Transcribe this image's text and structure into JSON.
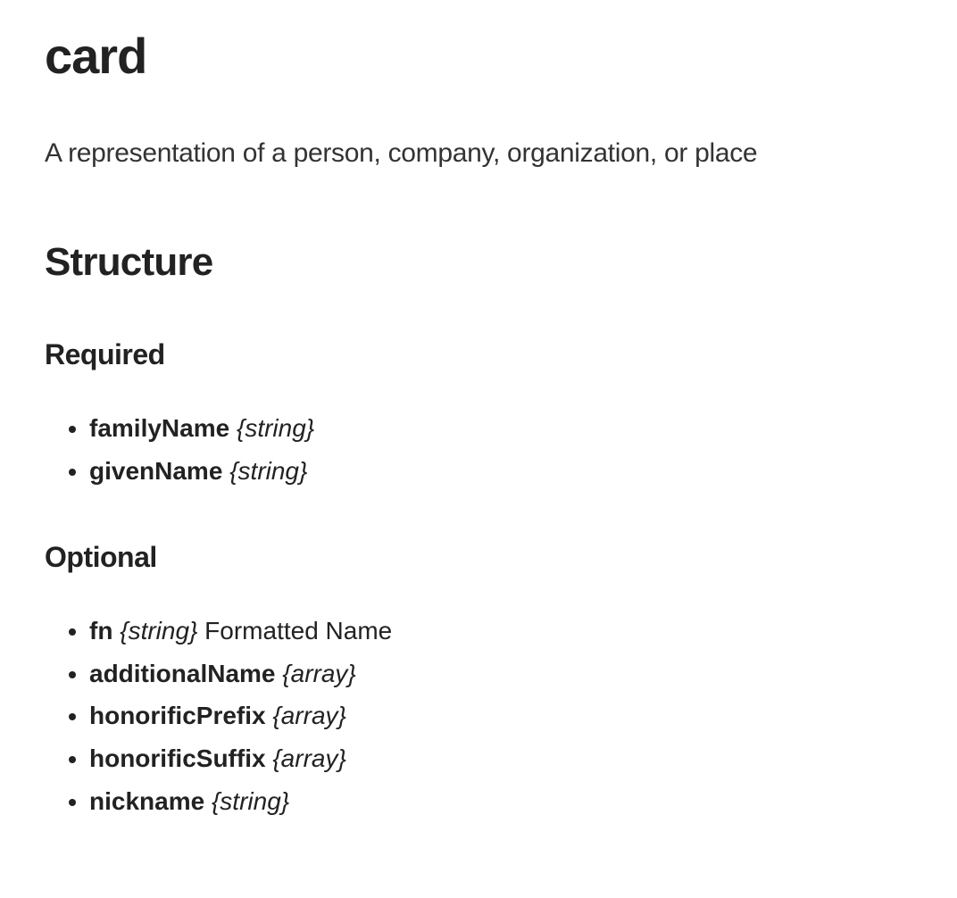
{
  "title": "card",
  "description": "A representation of a person, company, organization, or place",
  "structure": {
    "heading": "Structure",
    "sections": [
      {
        "heading": "Required",
        "props": [
          {
            "name": "familyName",
            "type": "{string}",
            "desc": ""
          },
          {
            "name": "givenName",
            "type": "{string}",
            "desc": ""
          }
        ]
      },
      {
        "heading": "Optional",
        "props": [
          {
            "name": "fn",
            "type": "{string}",
            "desc": "Formatted Name"
          },
          {
            "name": "additionalName",
            "type": "{array}",
            "desc": ""
          },
          {
            "name": "honorificPrefix",
            "type": "{array}",
            "desc": ""
          },
          {
            "name": "honorificSuffix",
            "type": "{array}",
            "desc": ""
          },
          {
            "name": "nickname",
            "type": "{string}",
            "desc": ""
          }
        ]
      }
    ]
  }
}
